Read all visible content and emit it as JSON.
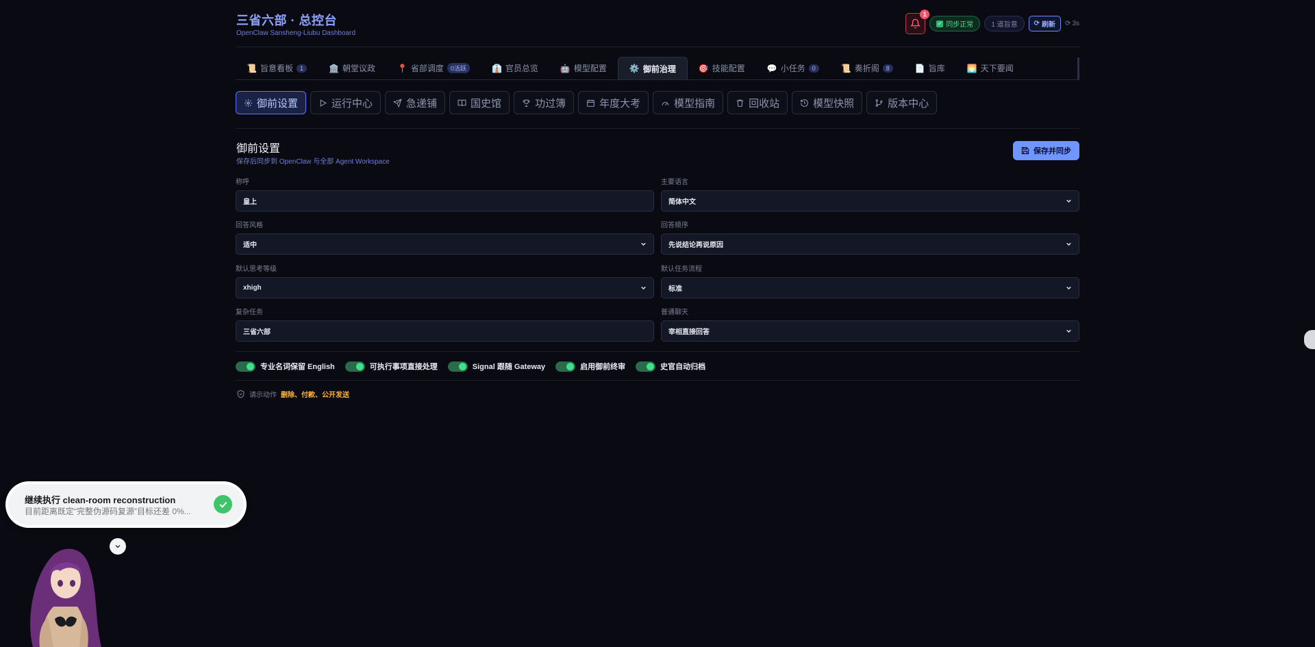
{
  "header": {
    "title": "三省六部 · 总控台",
    "subtitle": "OpenClaw Sansheng-Liubu Dashboard",
    "notif_count": "1",
    "sync_status": "同步正常",
    "decree_count": "1 道旨意",
    "refresh_label": "刷新",
    "timer": "3s"
  },
  "tabs": [
    {
      "icon": "📜",
      "label": "旨意看板",
      "badge": "1"
    },
    {
      "icon": "🏛️",
      "label": "朝堂议政",
      "badge": ""
    },
    {
      "icon": "📍",
      "label": "省部调度",
      "badge": "0活跃"
    },
    {
      "icon": "👔",
      "label": "官员总览",
      "badge": ""
    },
    {
      "icon": "🤖",
      "label": "模型配置",
      "badge": ""
    },
    {
      "icon": "⚙️",
      "label": "御前治理",
      "badge": ""
    },
    {
      "icon": "🎯",
      "label": "技能配置",
      "badge": ""
    },
    {
      "icon": "💬",
      "label": "小任务",
      "badge": "0"
    },
    {
      "icon": "📜",
      "label": "奏折阁",
      "badge": "8"
    },
    {
      "icon": "📄",
      "label": "旨库",
      "badge": ""
    },
    {
      "icon": "🌅",
      "label": "天下要闻",
      "badge": ""
    }
  ],
  "subnav": [
    "御前设置",
    "运行中心",
    "急递铺",
    "国史馆",
    "功过簿",
    "年度大考",
    "模型指南",
    "回收站",
    "模型快照",
    "版本中心"
  ],
  "section": {
    "title": "御前设置",
    "subtitle": "保存后同步到 OpenClaw 与全部 Agent Workspace",
    "save_label": "保存并同步"
  },
  "fields": [
    {
      "label": "称呼",
      "value": "皇上",
      "select": false
    },
    {
      "label": "主要语言",
      "value": "简体中文",
      "select": true
    },
    {
      "label": "回答风格",
      "value": "适中",
      "select": true
    },
    {
      "label": "回答顺序",
      "value": "先说结论再说原因",
      "select": true
    },
    {
      "label": "默认思考等级",
      "value": "xhigh",
      "select": true
    },
    {
      "label": "默认任务流程",
      "value": "标准",
      "select": true
    },
    {
      "label": "复杂任务",
      "value": "三省六部",
      "select": false
    },
    {
      "label": "普通聊天",
      "value": "宰相直接回答",
      "select": true
    }
  ],
  "toggles": [
    "专业名词保留 English",
    "可执行事项直接处理",
    "Signal 跟随 Gateway",
    "启用御前终审",
    "史官自动归档"
  ],
  "confirm": {
    "label": "请示动作",
    "actions": "删除、付款、公开发送"
  },
  "toast": {
    "title": "继续执行 clean-room reconstruction",
    "body": "目前距离既定“完整伪源码复源”目标还差 0%..."
  },
  "colors": {
    "accent": "#6f95ff",
    "title": "#8ea2ff",
    "success": "#3fe08a",
    "warning": "#ffb43a",
    "danger": "#ff4f6a"
  }
}
